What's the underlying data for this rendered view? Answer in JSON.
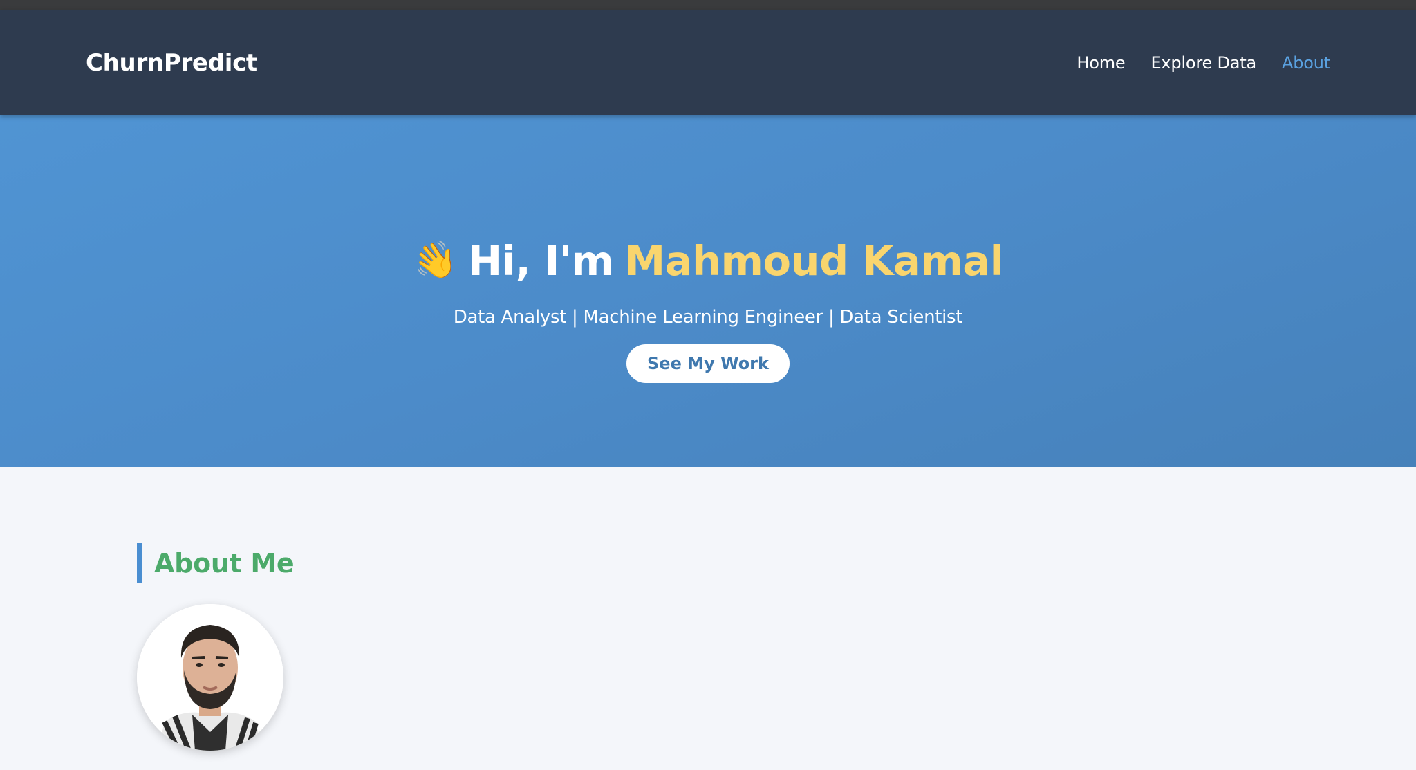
{
  "navbar": {
    "brand": "ChurnPredict",
    "links": [
      {
        "label": "Home",
        "active": false
      },
      {
        "label": "Explore Data",
        "active": false
      },
      {
        "label": "About",
        "active": true
      }
    ]
  },
  "hero": {
    "greeting": "Hi, I'm",
    "name": "Mahmoud Kamal",
    "icon": "waving-hand-icon",
    "subtitle": "Data Analyst | Machine Learning Engineer | Data Scientist",
    "cta_label": "See My Work"
  },
  "about": {
    "heading": "About Me",
    "avatar_icon": "profile-photo"
  },
  "colors": {
    "navbar_bg": "#2e3b4f",
    "hero_bg": "#4c8bc9",
    "name_highlight": "#f9d56e",
    "active_link": "#5aa1e0",
    "heading_green": "#4caa6a",
    "accent_bar": "#4a8ed1"
  }
}
